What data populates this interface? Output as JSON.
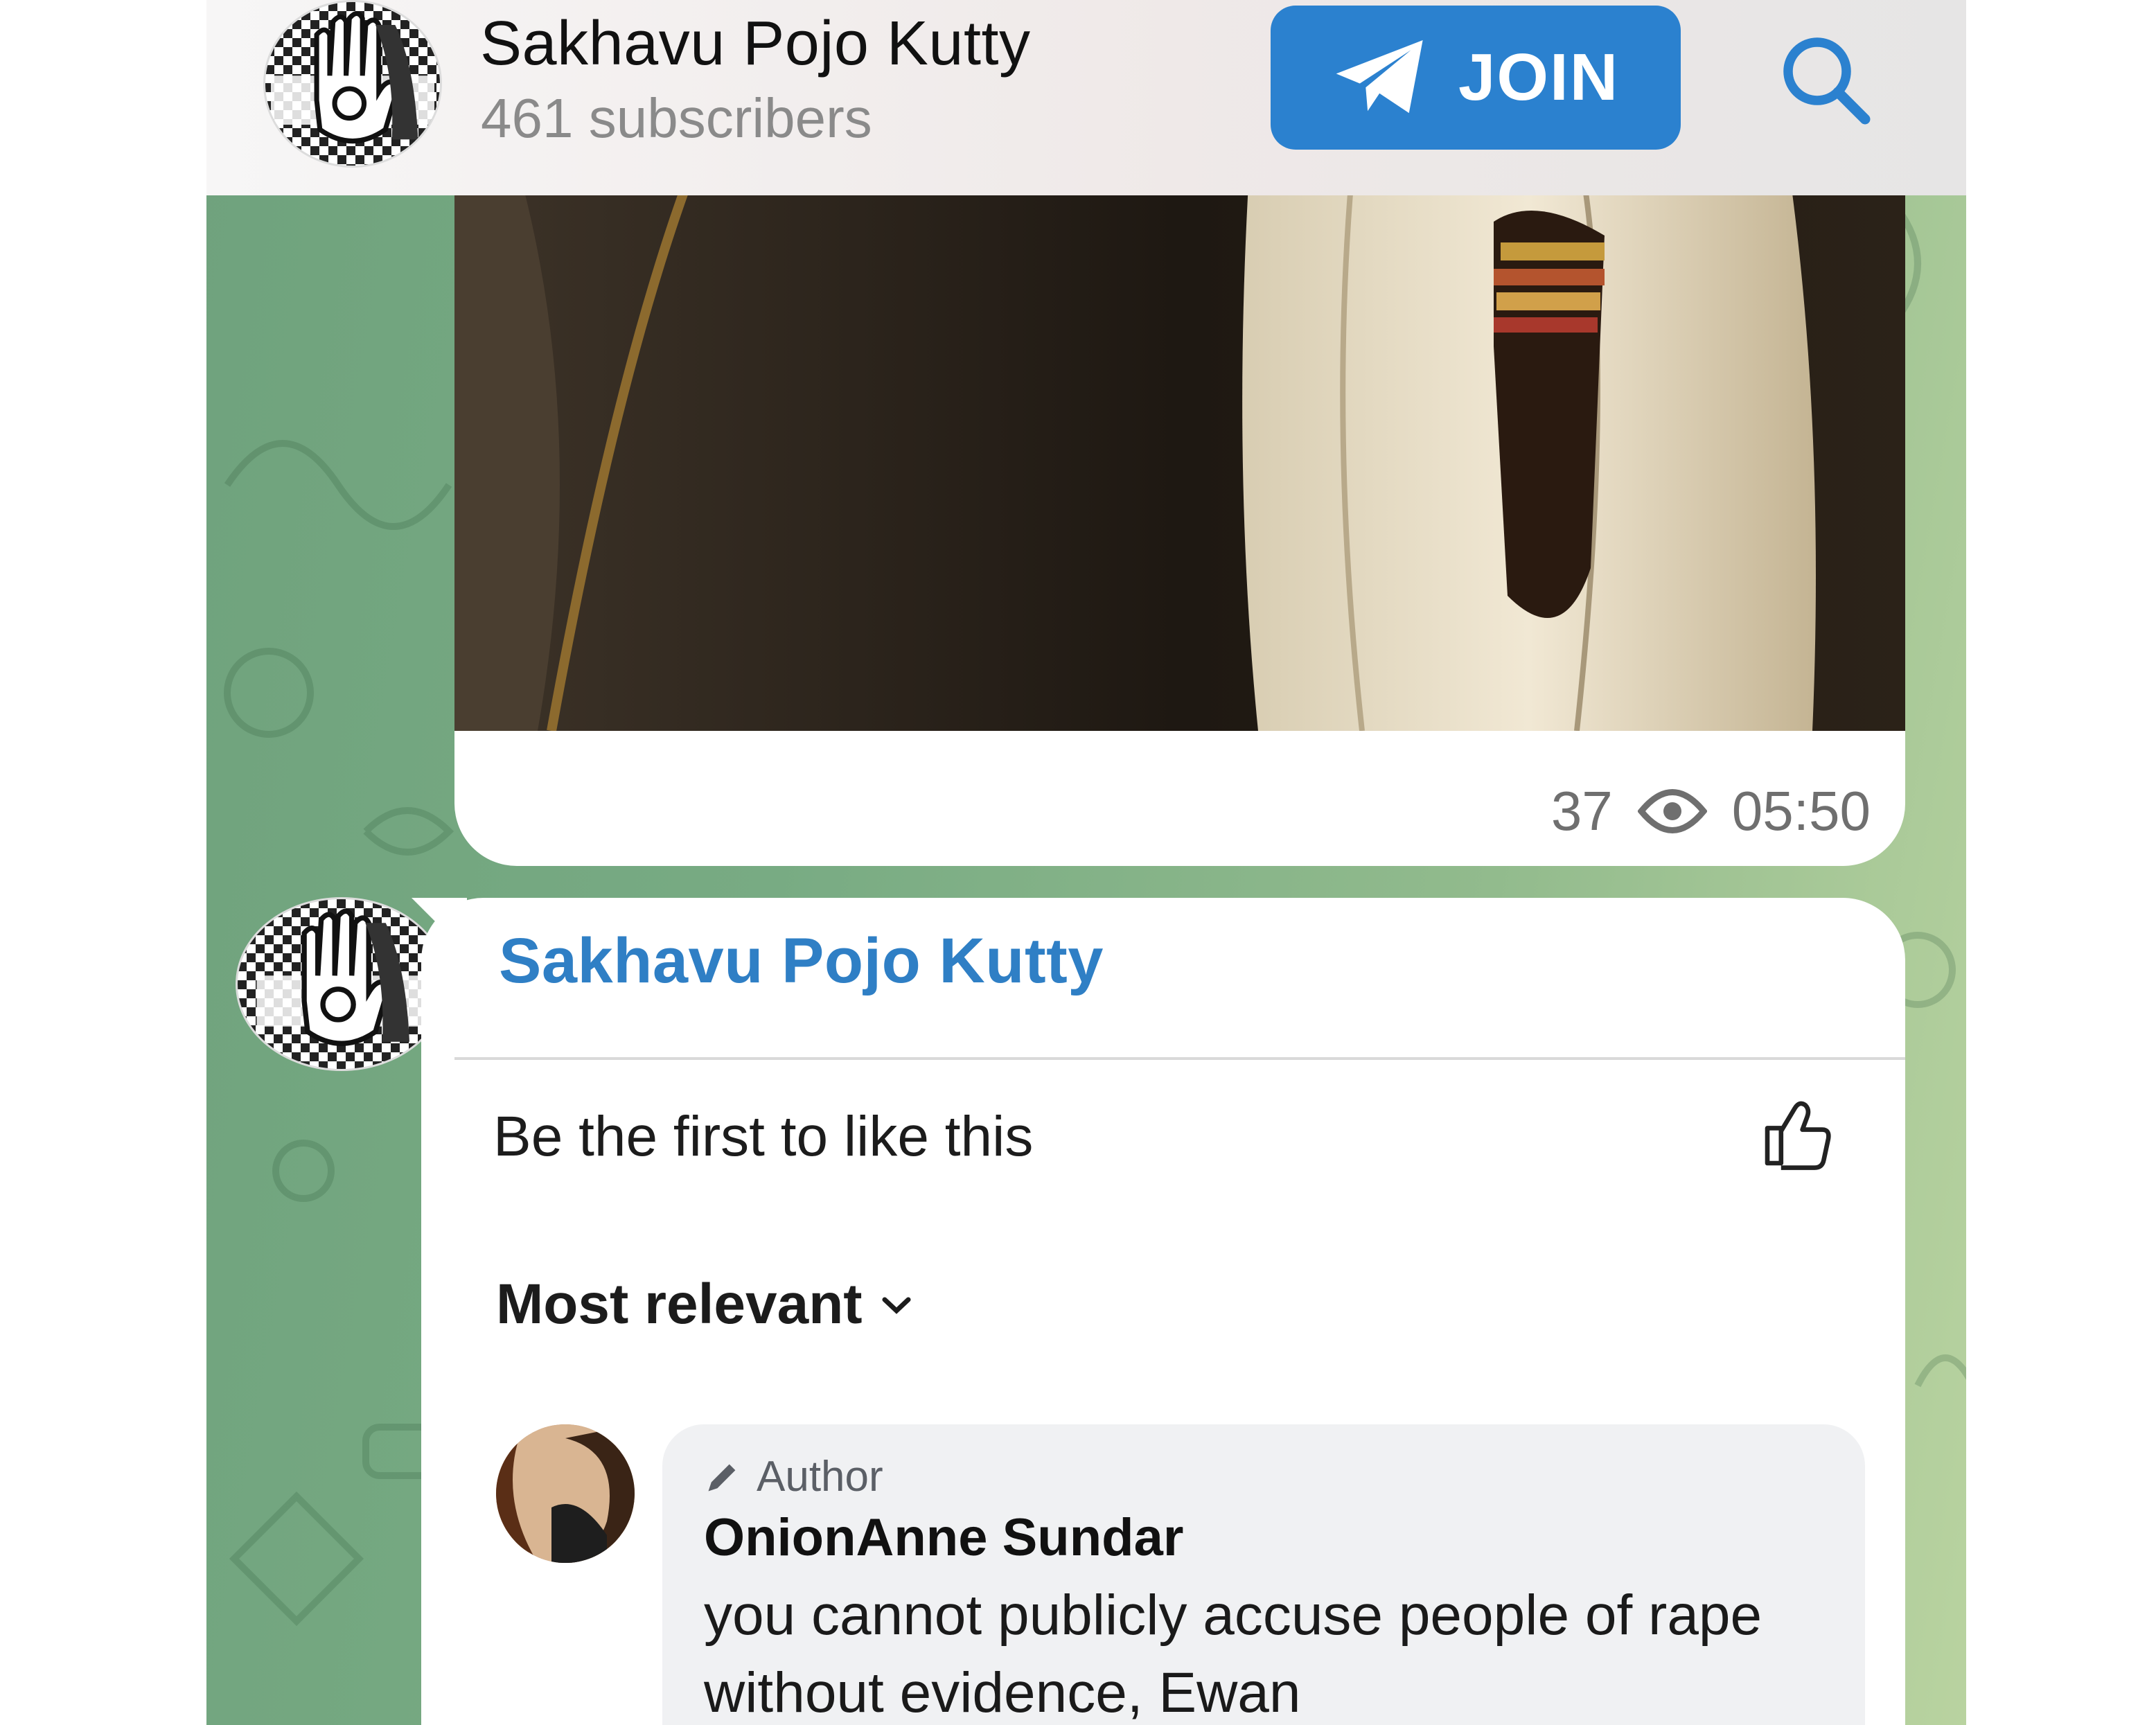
{
  "header": {
    "channel_name": "Sakhavu Pojo Kutty",
    "subscribers": "461 subscribers",
    "join_label": "JOIN"
  },
  "post": {
    "views": "37",
    "time": "05:50"
  },
  "message": {
    "sender": "Sakhavu Pojo Kutty",
    "embedded": {
      "like_prompt": "Be the first to like this",
      "sort_label": "Most relevant",
      "comment": {
        "badge": "Author",
        "author": "OnionAnne Sundar",
        "text": "you cannot publicly accuse people of rape without evidence, Ewan"
      }
    }
  },
  "colors": {
    "join_bg": "#2b81cf",
    "accent": "#2f7fc5",
    "wallpaper": "#78ab83"
  },
  "icons": [
    "telegram-plane-icon",
    "search-icon",
    "eye-icon",
    "thumbs-up-icon",
    "chevron-down-icon",
    "pencil-icon"
  ]
}
